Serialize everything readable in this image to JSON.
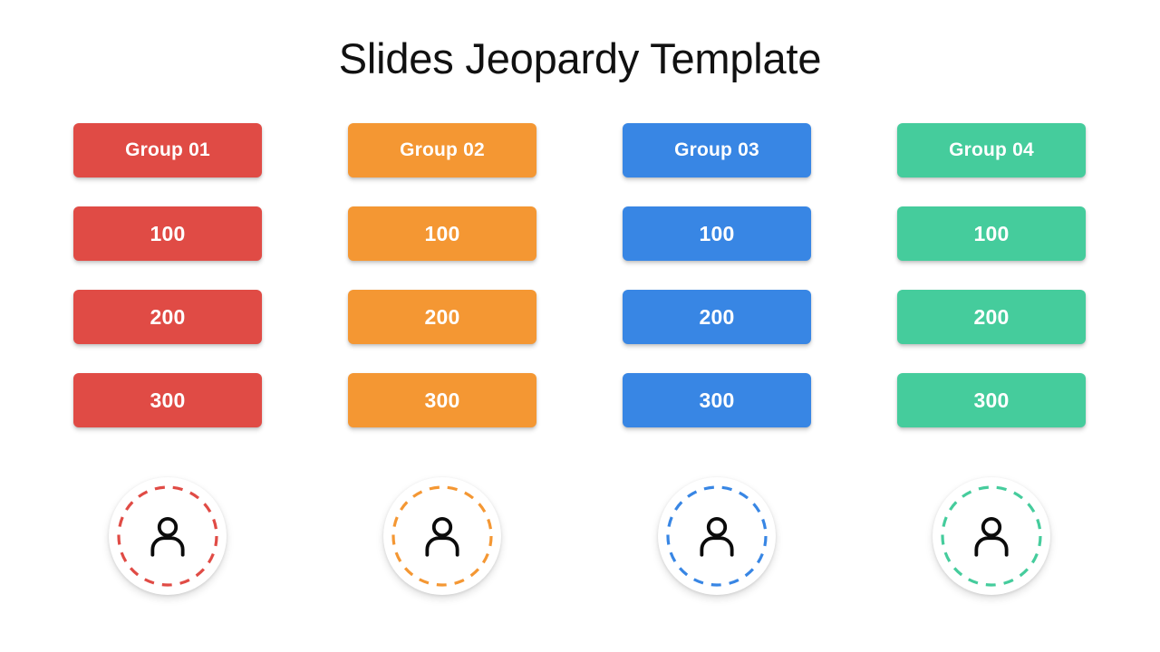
{
  "slide": {
    "title": "Slides Jeopardy Template",
    "background_color": "#ffffff"
  },
  "columns": [
    {
      "group_label": "Group 01",
      "color": "#E04B45",
      "values": [
        "100",
        "200",
        "300"
      ],
      "avatar_icon": "person-icon",
      "avatar_ring_color": "#E04B45"
    },
    {
      "group_label": "Group 02",
      "color": "#F49733",
      "values": [
        "100",
        "200",
        "300"
      ],
      "avatar_icon": "person-icon",
      "avatar_ring_color": "#F49733"
    },
    {
      "group_label": "Group 03",
      "color": "#3886E4",
      "values": [
        "100",
        "200",
        "300"
      ],
      "avatar_icon": "person-icon",
      "avatar_ring_color": "#3886E4"
    },
    {
      "group_label": "Group 04",
      "color": "#45CC9C",
      "values": [
        "100",
        "200",
        "300"
      ],
      "avatar_icon": "person-icon",
      "avatar_ring_color": "#45CC9C"
    }
  ]
}
